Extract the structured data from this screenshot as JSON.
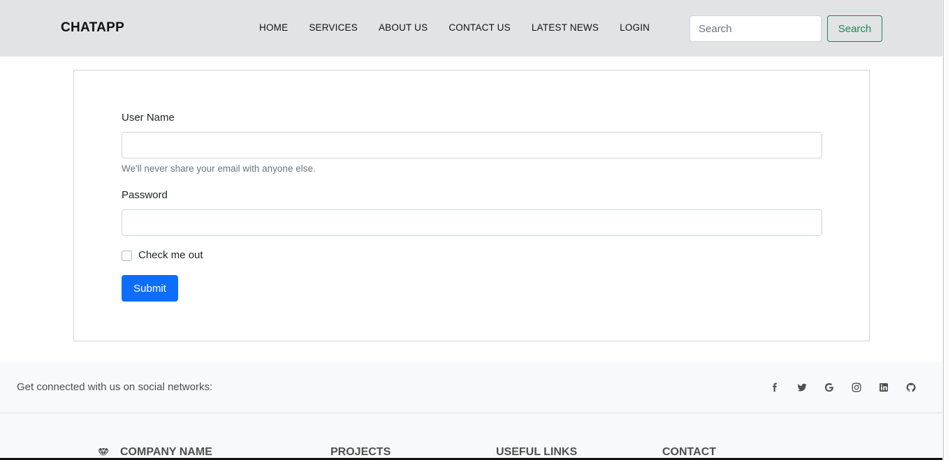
{
  "navbar": {
    "brand": "CHATAPP",
    "links": [
      "HOME",
      "SERVICES",
      "ABOUT US",
      "CONTACT US",
      "LATEST NEWS",
      "LOGIN"
    ],
    "search_placeholder": "Search",
    "search_button": "Search"
  },
  "form": {
    "username_label": "User Name",
    "username_value": "",
    "help_text": "We'll never share your email with anyone else.",
    "password_label": "Password",
    "password_value": "",
    "checkbox_label": "Check me out",
    "checkbox_checked": false,
    "submit_label": "Submit"
  },
  "social": {
    "text": "Get connected with us on social networks:",
    "icons": [
      "facebook-icon",
      "twitter-icon",
      "google-icon",
      "instagram-icon",
      "linkedin-icon",
      "github-icon"
    ]
  },
  "footer": {
    "headings": [
      "COMPANY NAME",
      "PROJECTS",
      "USEFUL LINKS",
      "CONTACT"
    ]
  },
  "colors": {
    "navbar_bg": "#e2e3e5",
    "primary": "#0d6efd",
    "success": "#198754",
    "footer_bg": "#f8f9fa",
    "muted_text": "#6c757d"
  }
}
